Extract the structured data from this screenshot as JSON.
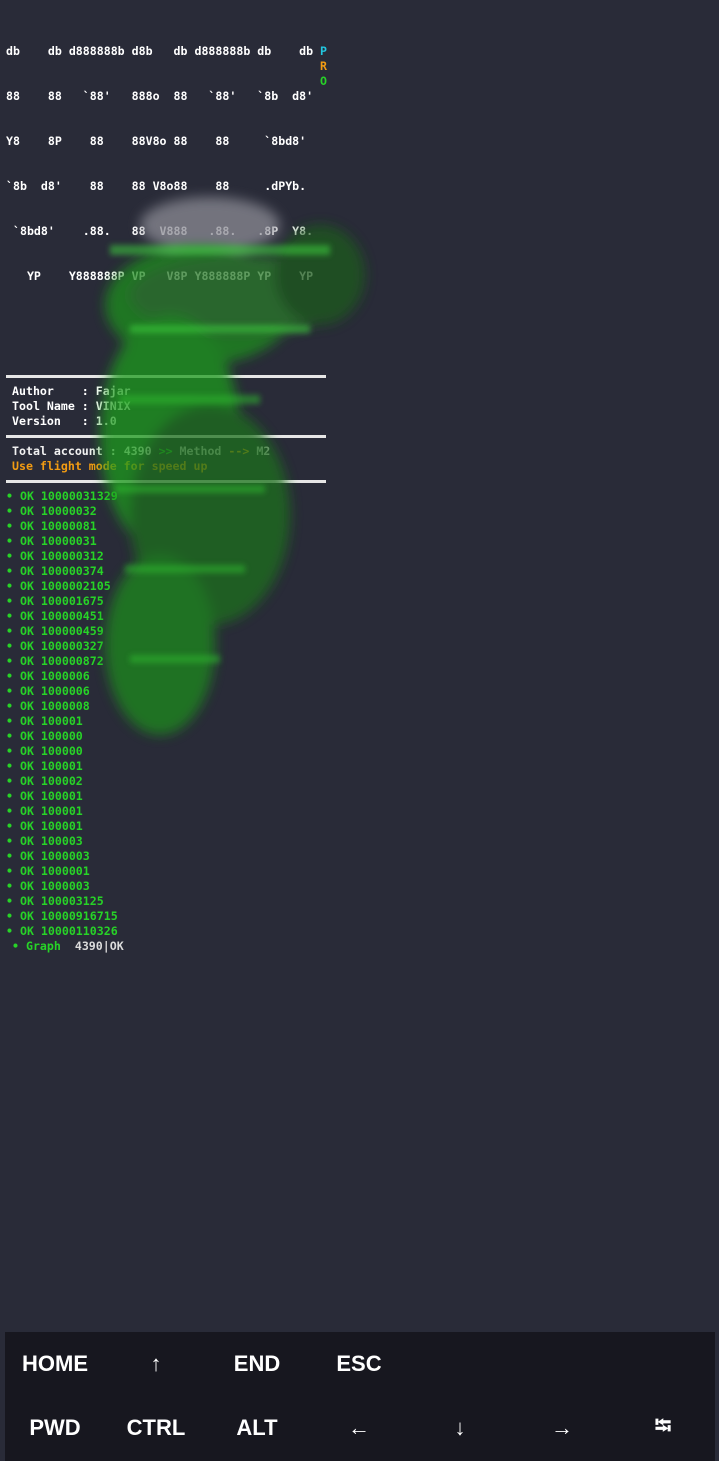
{
  "banner": {
    "lines": [
      "db    db d888888b d8b   db d888888b db    db",
      "88    88   `88'   888o  88   `88'   `8b  d8'",
      "Y8    8P    88    88V8o 88    88     `8bd8' ",
      "`8b  d8'    88    88 V8o88    88     .dPYb. ",
      " `8bd8'    .88.   88  V888   .88.   .8P  Y8.",
      "   YP    Y888888P VP   V8P Y888888P YP    YP"
    ],
    "side_letters": [
      "P",
      "R",
      "O"
    ],
    "side_colors": [
      "#22c7e0",
      "#f39c12",
      "#27d327"
    ]
  },
  "info": {
    "author": "Author    : Fajar",
    "tool_name": "Tool Name : VINIX",
    "version": "Version   : 1.0"
  },
  "status": {
    "total_label": "Total account : ",
    "total_value": "4390",
    "arrow1": " >> ",
    "method_label": "Method",
    "arrow2": " --> ",
    "method_value": "M2",
    "warning": "Use flight mode for speed up"
  },
  "results": [
    "• OK 10000031329",
    "• OK 10000032",
    "• OK 10000081",
    "• OK 10000031",
    "• OK 100000312",
    "• OK 100000374",
    "• OK 1000002105",
    "• OK 100001675",
    "• OK 100000451",
    "• OK 100000459",
    "• OK 100000327",
    "• OK 100000872",
    "• OK 1000006",
    "• OK 1000006",
    "• OK 1000008",
    "• OK 100001",
    "• OK 100000",
    "• OK 100000",
    "• OK 100001",
    "• OK 100002",
    "• OK 100001",
    "• OK 100001",
    "• OK 100001",
    "• OK 100003",
    "• OK 1000003",
    "• OK 1000001",
    "• OK 1000003",
    "• OK 100003125",
    "• OK 10000916715",
    "• OK 10000110326"
  ],
  "graph": {
    "label": "• Graph",
    "count": "4390|OK"
  },
  "keyboard": {
    "row1": [
      "HOME",
      "↑",
      "END",
      "ESC"
    ],
    "row2": [
      "PWD",
      "CTRL",
      "ALT",
      "←",
      "↓",
      "→",
      "⭾"
    ]
  }
}
